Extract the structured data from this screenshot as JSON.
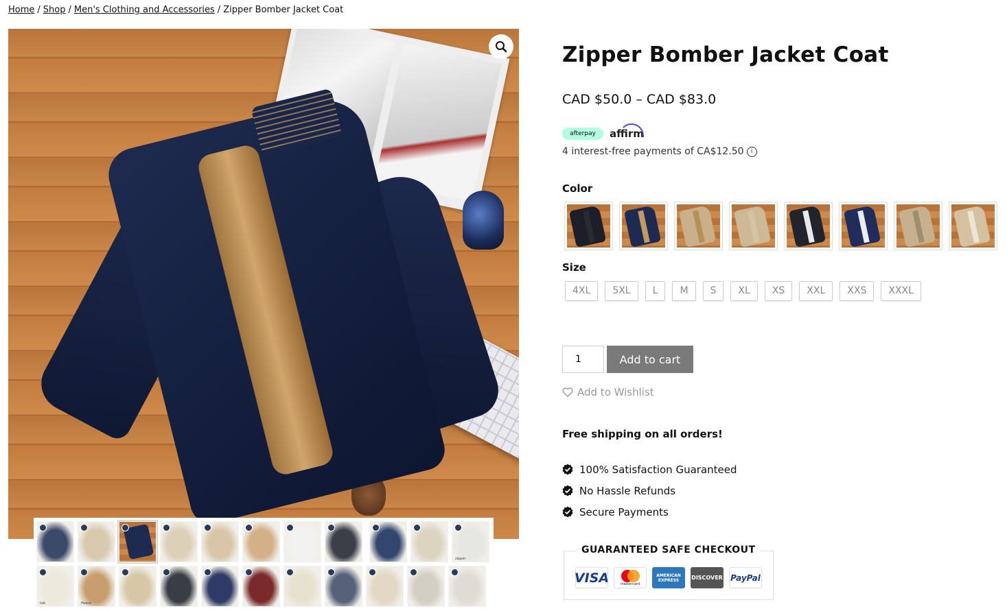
{
  "breadcrumb": {
    "items": [
      "Home",
      "Shop",
      "Men's Clothing and Accessories"
    ],
    "current": "Zipper Bomber Jacket Coat",
    "separator": "/"
  },
  "product": {
    "title": "Zipper Bomber Jacket Coat",
    "price_range": "CAD $50.0 – CAD $83.0",
    "afterpay_label": "afterpay",
    "affirm_label": "affirm",
    "installments_text": "4 interest-free payments of CA$12.50",
    "info_icon": "i"
  },
  "options": {
    "color_label": "Color",
    "colors": [
      {
        "name": "black",
        "jacket": "#1c1f2a",
        "lining": "#2a2a30"
      },
      {
        "name": "navy",
        "jacket": "#1d2a52",
        "lining": "#c49a62"
      },
      {
        "name": "khaki-fleece",
        "jacket": "#c9b08a",
        "lining": "#b88f5a"
      },
      {
        "name": "khaki",
        "jacket": "#cdb996",
        "lining": "#d6c3a3"
      },
      {
        "name": "black-white",
        "jacket": "#22242c",
        "lining": "#e9e9e9"
      },
      {
        "name": "navy-white",
        "jacket": "#1f2c5c",
        "lining": "#ececec"
      },
      {
        "name": "beige",
        "jacket": "#c7b08e",
        "lining": "#9f8f6f"
      },
      {
        "name": "beige-light",
        "jacket": "#d3c1a2",
        "lining": "#ece4d4"
      }
    ],
    "size_label": "Size",
    "sizes": [
      "4XL",
      "5XL",
      "L",
      "M",
      "S",
      "XL",
      "XS",
      "XXL",
      "XXS",
      "XXXL"
    ]
  },
  "cart": {
    "quantity": "1",
    "add_to_cart_label": "Add to cart",
    "wishlist_label": "Add to Wishlist"
  },
  "shipping": {
    "free_shipping_text": "Free shipping on all orders!"
  },
  "benefits": [
    "100% Satisfaction Guaranteed",
    "No Hassle Refunds",
    "Secure Payments"
  ],
  "checkout": {
    "title": "GUARANTEED SAFE CHECKOUT",
    "cards": [
      {
        "name": "visa",
        "label": "VISA",
        "bg": "#fff",
        "color": "#1a3b8f"
      },
      {
        "name": "mastercard",
        "label": "mastercard",
        "bg": "#fff",
        "color": "#222"
      },
      {
        "name": "amex",
        "label": "AMERICAN EXPRESS",
        "bg": "#2e77bb",
        "color": "#fff"
      },
      {
        "name": "discover",
        "label": "DISCOVER",
        "bg": "#555",
        "color": "#fff"
      },
      {
        "name": "paypal",
        "label": "PayPal",
        "bg": "#fff",
        "color": "#1d3c85"
      }
    ]
  },
  "gallery": {
    "zoom_icon": "magnifier-icon",
    "thumbnails": [
      {
        "color": "#3c4a6a"
      },
      {
        "color": "#d9c9ae"
      },
      {
        "color": "#1d2a52",
        "active": true
      },
      {
        "color": "#ddd0b8"
      },
      {
        "color": "#d9c6a8"
      },
      {
        "color": "#d4b088"
      },
      {
        "color": "#f2f2f2"
      },
      {
        "color": "#3b3f47"
      },
      {
        "color": "#33466f"
      },
      {
        "color": "#ddd3c1"
      },
      {
        "color": "#e6e6e2",
        "caption": "zipper"
      },
      {
        "color": "#eee9dd",
        "caption": "tab"
      },
      {
        "color": "#c89e6e",
        "caption": "fleece"
      },
      {
        "color": "#d8c7a6"
      },
      {
        "color": "#3a3d45"
      },
      {
        "color": "#2f3a66"
      },
      {
        "color": "#7a2a2a"
      },
      {
        "color": "#e7e1cf"
      },
      {
        "color": "#56617a"
      },
      {
        "color": "#e3d8c5"
      },
      {
        "color": "#d4cfc4"
      },
      {
        "color": "#dfdcd6"
      }
    ]
  }
}
